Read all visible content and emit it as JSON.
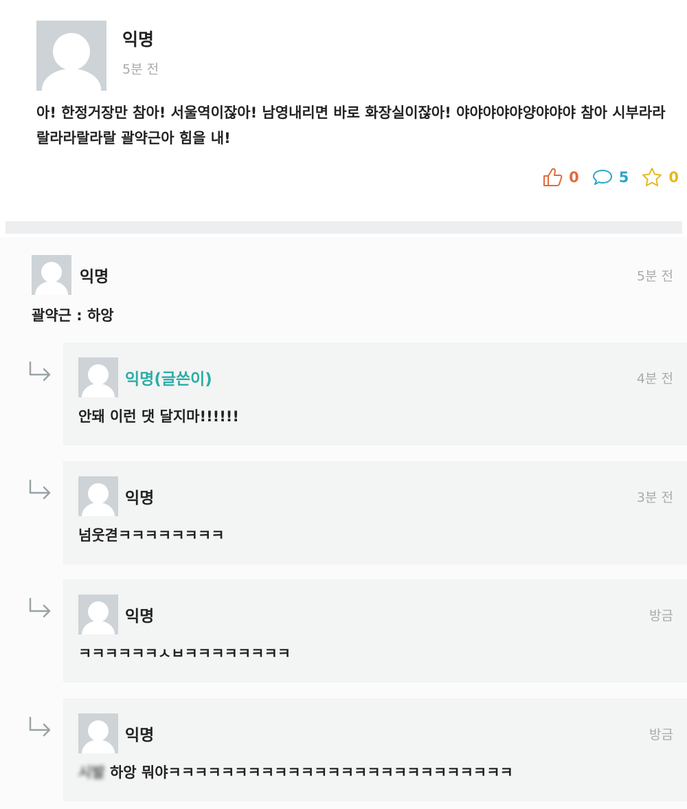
{
  "post": {
    "author": "익명",
    "time": "5분 전",
    "body": "아! 한정거장만 참아! 서울역이잖아! 남영내리면 바로 화장실이잖아! 야야야야야양야야야 참아 시부라라랄라라랄라랄 괄약근아 힘을 내!",
    "likes": "0",
    "comments": "5",
    "favorites": "0"
  },
  "comment": {
    "author": "익명",
    "time": "5분 전",
    "text": "괄약근 : 하앙"
  },
  "replies": [
    {
      "author": "익명(글쓴이)",
      "time": "4분 전",
      "text": "안돼 이런 댓 달지마!!!!!!"
    },
    {
      "author": "익명",
      "time": "3분 전",
      "text": "넘웃겯ㅋㅋㅋㅋㅋㅋㅋㅋ"
    },
    {
      "author": "익명",
      "time": "방금",
      "text": "ㅋㅋㅋㅋㅋㅋㅅㅂㅋㅋㅋㅋㅋㅋㅋㅋ"
    },
    {
      "author": "익명",
      "time": "방금",
      "blurred": "시발",
      "text": " 하앙 뭐야ㅋㅋㅋㅋㅋㅋㅋㅋㅋㅋㅋㅋㅋㅋㅋㅋㅋㅋㅋㅋㅋㅋㅋㅋㅋㅋ"
    }
  ],
  "colors": {
    "writer": "#2aaea6",
    "like": "#e26a3c",
    "comment": "#2aa6c6",
    "favorite": "#e6b820"
  },
  "icons": [
    "thumbs-up-icon",
    "speech-bubble-icon",
    "star-icon",
    "reply-arrow-icon",
    "default-avatar"
  ]
}
